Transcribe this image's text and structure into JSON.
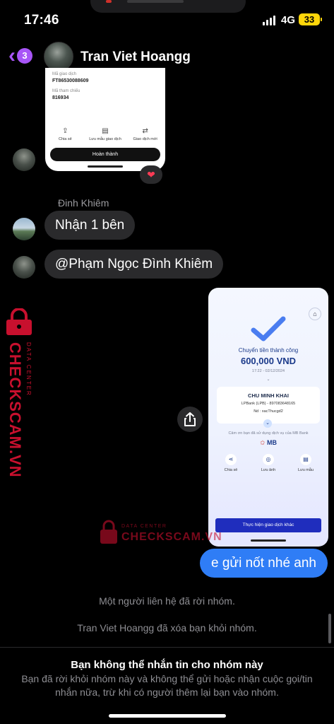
{
  "status_bar": {
    "time": "17:46",
    "network": "4G",
    "battery": "33"
  },
  "header": {
    "back_badge": "3",
    "title": "Tran Viet Hoangg"
  },
  "card1": {
    "rows": [
      {
        "label": "Mã giao dịch",
        "value": "FT86530088609"
      },
      {
        "label": "Mã tham chiếu",
        "value": "816934"
      }
    ],
    "actions": [
      "Chia sẻ",
      "Lưu mẫu giao dịch",
      "Giao dịch mới"
    ],
    "button": "Hoàn thành",
    "reaction": "❤"
  },
  "messages": {
    "sender_name": "Đinh Khiêm",
    "bubble1": "Nhận 1 bên",
    "bubble2": "@Phạm Ngọc Đình Khiêm",
    "outgoing": "e gửi nốt nhé anh"
  },
  "card2": {
    "success": "Chuyển tiền thành công",
    "amount": "600,000 VND",
    "date": "17:22 - 02/12/2024",
    "recipient": "CHU MINH KHAI",
    "bank": "LPBank (LPB) - 897083648165",
    "memo": "Nd : xacThucgd2",
    "thanks": "Cảm ơn bạn đã sử dụng dịch vụ của MB Bank",
    "brand": "MB",
    "actions": [
      "Chia sẻ",
      "Lưu ảnh",
      "Lưu mẫu"
    ],
    "button": "Thực hiện giao dịch khác"
  },
  "watermark": {
    "big": "CHECKSCAM.VN",
    "small": "DATA CENTER"
  },
  "system_notices": [
    "Một người liên hệ đã rời nhóm.",
    "Tran Viet Hoangg đã xóa bạn khỏi nhóm."
  ],
  "footer": {
    "title": "Bạn không thể nhắn tin cho nhóm này",
    "text": "Bạn đã rời khỏi nhóm này và không thể gửi hoặc nhận cuộc gọi/tin nhắn nữa, trừ khi có người thêm lại bạn vào nhóm."
  },
  "colors": {
    "accent": "#a855f7",
    "outgoing_bubble": "#2f7df6",
    "incoming_bubble": "#2a2a2c",
    "watermark": "#c8102e"
  }
}
